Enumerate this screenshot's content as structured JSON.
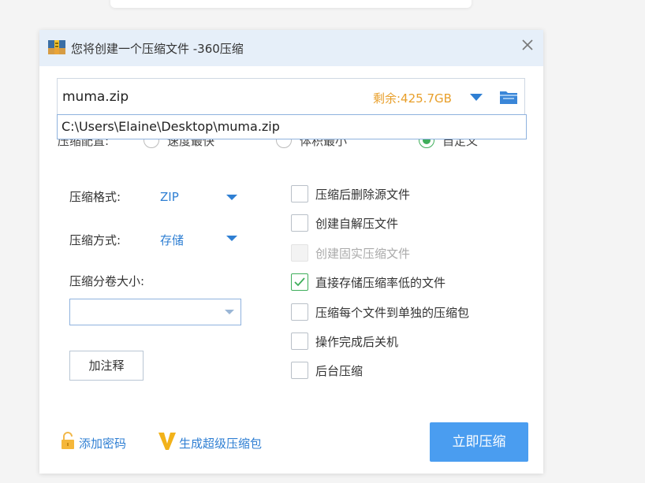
{
  "window": {
    "title": "您将创建一个压缩文件 -360压缩"
  },
  "archive": {
    "name": "muma.zip",
    "free_space": "剩余:425.7GB",
    "path_suggestion": "C:\\Users\\Elaine\\Desktop\\muma.zip"
  },
  "compression_mode": {
    "label": "压缩配置:",
    "options": [
      "速度最快",
      "体积最小",
      "自定义"
    ],
    "selected": "自定义"
  },
  "settings": {
    "format_label": "压缩格式:",
    "format_value": "ZIP",
    "method_label": "压缩方式:",
    "method_value": "存储",
    "volume_label": "压缩分卷大小:",
    "volume_value": "",
    "comment_button": "加注释"
  },
  "options": [
    {
      "label": "压缩后删除源文件",
      "checked": false,
      "enabled": true
    },
    {
      "label": "创建自解压文件",
      "checked": false,
      "enabled": true
    },
    {
      "label": "创建固实压缩文件",
      "checked": false,
      "enabled": false
    },
    {
      "label": "直接存储压缩率低的文件",
      "checked": true,
      "enabled": true
    },
    {
      "label": "压缩每个文件到单独的压缩包",
      "checked": false,
      "enabled": true
    },
    {
      "label": "操作完成后关机",
      "checked": false,
      "enabled": true
    },
    {
      "label": "后台压缩",
      "checked": false,
      "enabled": true
    }
  ],
  "footer": {
    "password_link": "添加密码",
    "super_package_link": "生成超级压缩包",
    "start_button": "立即压缩"
  },
  "colors": {
    "accent_blue": "#2f7fd3",
    "button_blue": "#4a9df0",
    "free_space_orange": "#e89f2a",
    "check_green": "#3fae5b",
    "titlebar_bg": "#e6eff9"
  },
  "icons": [
    "app-icon",
    "close-icon",
    "dropdown-arrow-icon",
    "folder-icon",
    "lock-icon",
    "super-v-icon",
    "checkmark-icon"
  ]
}
